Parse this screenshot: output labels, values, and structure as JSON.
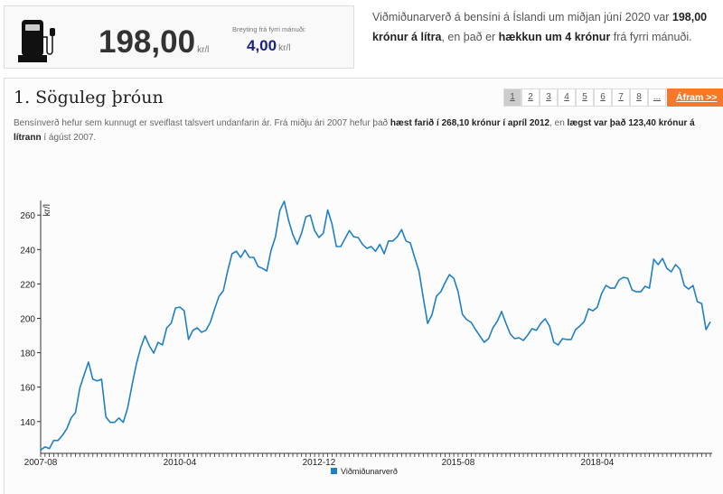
{
  "top": {
    "icon": "fuel-pump-icon",
    "price": "198,00",
    "price_unit": "kr/l",
    "change_label": "Breyting frá fyrri mánuði:",
    "change": "4,00",
    "change_unit": "kr/l"
  },
  "summary": {
    "t1": "Viðmiðunarverð á bensíni á Íslandi um miðjan júní 2020 var ",
    "b1": "198,00 krónur á lítra",
    "t2": ", en það er ",
    "b2": "hækkun um 4 krónur",
    "t3": " frá fyrri mánuði."
  },
  "section": {
    "title": "1. Söguleg þróun",
    "pages": [
      "1",
      "2",
      "3",
      "4",
      "5",
      "6",
      "7",
      "8",
      "..."
    ],
    "next_label": "Áfram >>",
    "intro": {
      "t1": "Bensínverð hefur sem kunnugt er sveiflast talsvert undanfarin ár. Frá miðju ári 2007 hefur það ",
      "b1": "hæst farið í 268,10 krónur í apríl 2012",
      "t2": ", en ",
      "b2": "lægst var það 123,40 krónur á lítrann",
      "t3": " í ágúst 2007."
    }
  },
  "colors": {
    "line": "#1f80c4",
    "accent": "#f47a2a",
    "change": "#1a237e"
  },
  "chart_data": {
    "type": "line",
    "title": "",
    "xlabel": "",
    "ylabel": "kr/l",
    "x_start": "2007-08",
    "x_end": "2020-06",
    "x_step": "month",
    "x_tick_labels": [
      "2007-08",
      "2010-04",
      "2012-12",
      "2015-08",
      "2018-04"
    ],
    "x_tick_index": [
      0,
      32,
      64,
      96,
      128
    ],
    "y_ticks": [
      140,
      160,
      180,
      200,
      220,
      240,
      260
    ],
    "ylim": [
      121.5,
      268.5
    ],
    "grid": false,
    "legend_position": "bottom",
    "series": [
      {
        "name": "Viðmiðunarverð",
        "values": [
          123.4,
          125.3,
          124.3,
          129,
          129,
          132,
          135.8,
          142.1,
          145.2,
          159.4,
          167.2,
          174.6,
          164.6,
          163.6,
          164.6,
          142.6,
          139.5,
          139.5,
          142.1,
          139.5,
          147.8,
          160.9,
          173.5,
          183,
          189.8,
          184,
          179.8,
          186.1,
          184.5,
          194.5,
          197.1,
          206,
          206.5,
          204.4,
          187.7,
          193,
          194.5,
          191.9,
          193,
          197.6,
          205.5,
          212.8,
          216,
          227.5,
          237.5,
          239,
          235.4,
          239.6,
          235.4,
          235.4,
          230.1,
          229,
          227.5,
          239.6,
          247.4,
          262.6,
          268.1,
          257,
          248.5,
          243,
          249.5,
          259,
          260,
          251,
          247,
          249.5,
          263,
          254.8,
          241.7,
          241.7,
          246.4,
          251,
          247.4,
          247,
          243,
          240.6,
          241.7,
          239,
          243,
          237.5,
          245,
          245,
          247.4,
          251.6,
          245,
          243.8,
          235.4,
          227.5,
          211.8,
          197,
          202.3,
          212.8,
          215.4,
          220.7,
          225.4,
          223.3,
          215.4,
          202.3,
          199.2,
          197.6,
          193.4,
          189.8,
          186.1,
          188.2,
          194.5,
          198.2,
          204,
          197,
          190.8,
          188.2,
          188.7,
          187.1,
          190.3,
          194,
          193,
          197,
          199.7,
          195.5,
          186.1,
          184.5,
          188.2,
          187.7,
          187.7,
          193.4,
          195.5,
          198.2,
          205.5,
          204.4,
          206.5,
          214.4,
          219.1,
          217.5,
          217.5,
          222.3,
          223.8,
          223.3,
          216.5,
          215.4,
          215.4,
          218.6,
          217.5,
          234.3,
          231.2,
          234.8,
          229,
          227,
          231.2,
          228.6,
          219.1,
          217,
          219.1,
          209.7,
          208.6,
          193.4,
          198
        ]
      }
    ]
  }
}
